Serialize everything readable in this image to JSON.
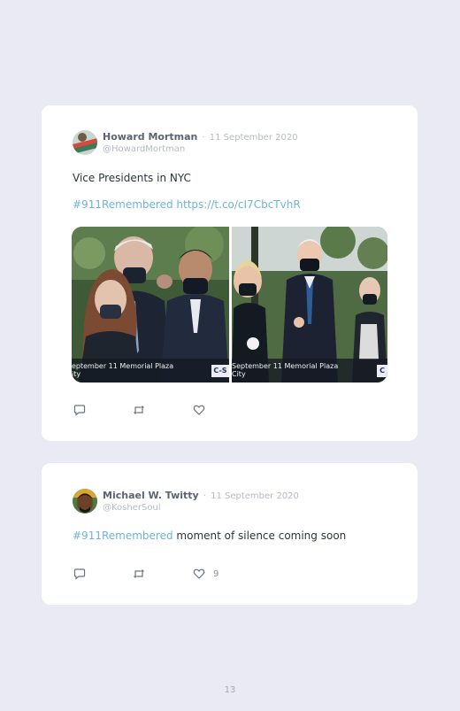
{
  "tweets": [
    {
      "name": "Howard Mortman",
      "separator": "·",
      "date": "11 September 2020",
      "handle": "@HowardMortman",
      "text": "Vice Presidents in NYC",
      "hashtag": "#911Remembered",
      "url": "https://t.co/cI7CbcTvhR",
      "media": [
        {
          "caption_line1": "eptember 11 Memorial Plaza",
          "caption_line2": "ity",
          "badge": "C-S"
        },
        {
          "caption_line1": "September 11 Memorial Plaza",
          "caption_line2": "City",
          "badge": "C"
        }
      ],
      "like_count": ""
    },
    {
      "name": "Michael W. Twitty",
      "separator": "·",
      "date": "11 September 2020",
      "handle": "@KosherSoul",
      "hashtag": "#911Remembered",
      "text": "moment of silence coming soon",
      "like_count": "9"
    }
  ],
  "icons": {
    "reply": "reply-icon",
    "retweet": "retweet-icon",
    "like": "like-icon"
  },
  "colors": {
    "link": "#6eb4d6",
    "name": "#5b6472",
    "muted": "#b6bbc4",
    "background": "#e9eaf3"
  },
  "page_number": "13"
}
